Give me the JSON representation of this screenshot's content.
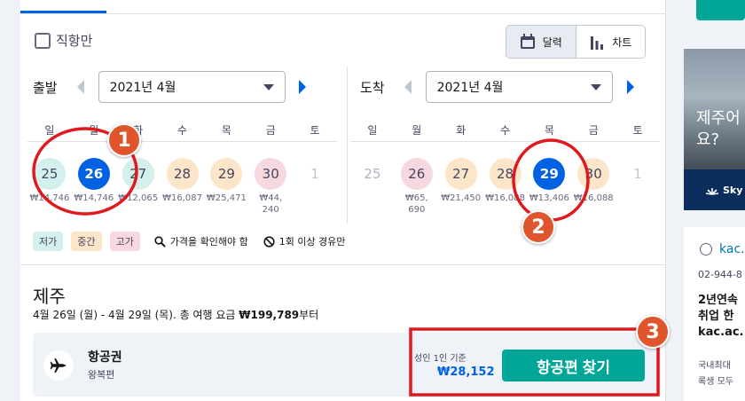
{
  "filters": {
    "direct_label": "직항만"
  },
  "view_toggle": {
    "calendar_label": "달력",
    "chart_label": "차트"
  },
  "depart": {
    "label": "출발",
    "month": "2021년 4월",
    "weekdays": [
      "일",
      "월",
      "화",
      "수",
      "목",
      "금",
      "토"
    ],
    "days": [
      {
        "day": "25",
        "price": "₩14,746",
        "level": "low"
      },
      {
        "day": "26",
        "price": "₩14,746",
        "level": "selected"
      },
      {
        "day": "27",
        "price": "₩12,065",
        "level": "low"
      },
      {
        "day": "28",
        "price": "₩16,087",
        "level": "mid"
      },
      {
        "day": "29",
        "price": "₩25,471",
        "level": "mid"
      },
      {
        "day": "30",
        "price": "₩44,\n240",
        "level": "high"
      },
      {
        "day": "1",
        "price": "",
        "level": "none"
      }
    ]
  },
  "arrive": {
    "label": "도착",
    "month": "2021년 4월",
    "weekdays": [
      "일",
      "월",
      "화",
      "수",
      "목",
      "금",
      "토"
    ],
    "days": [
      {
        "day": "25",
        "price": "",
        "level": "dim"
      },
      {
        "day": "26",
        "price": "₩65,\n690",
        "level": "high"
      },
      {
        "day": "27",
        "price": "₩21,450",
        "level": "mid"
      },
      {
        "day": "28",
        "price": "₩16,088",
        "level": "mid"
      },
      {
        "day": "29",
        "price": "₩13,406",
        "level": "selected"
      },
      {
        "day": "30",
        "price": "₩16,088",
        "level": "mid"
      },
      {
        "day": "1",
        "price": "",
        "level": "none"
      }
    ]
  },
  "legend": {
    "low": "저가",
    "mid": "중간",
    "high": "고가",
    "check_price": "가격을 확인해야 함",
    "one_stop": "1회 이상 경유만"
  },
  "trip": {
    "city": "제주",
    "summary_prefix": "4월 26일 (월) - 4월 29일 (목). 총 여행 요금 ",
    "summary_total": "₩199,789",
    "summary_suffix": "부터"
  },
  "flight": {
    "title": "항공권",
    "subtitle": "왕복편",
    "per_label": "성인 1인 기준",
    "price": "₩28,152",
    "find_button": "항공편 찾기"
  },
  "ad": {
    "headline_1": "제주어",
    "headline_2": "요?",
    "brand": "Sky",
    "site": "kac.",
    "phone": "02-944-8",
    "head_1": "2년연속",
    "head_2": "취업 한",
    "head_3": "kac.ac.",
    "body_1": "국내최대",
    "body_2": "록생 모두"
  },
  "annotations": {
    "badge_1": "1",
    "badge_2": "2",
    "badge_3": "3"
  },
  "colors": {
    "accent_blue": "#0062e3",
    "teal": "#00a698",
    "low": "#d3f0ec",
    "mid": "#fde5c9",
    "high": "#f7d8df",
    "annotation_red": "#e0191e",
    "badge_orange": "#e0552c"
  }
}
